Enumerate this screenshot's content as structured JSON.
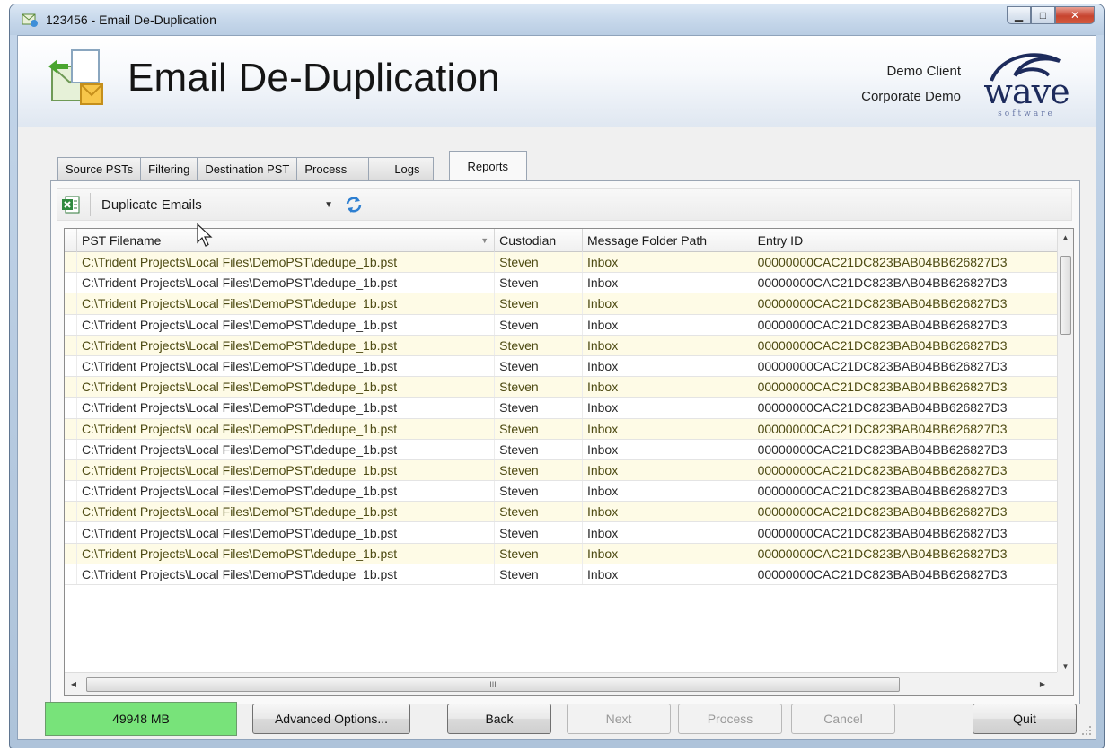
{
  "window": {
    "title": "123456 - Email De-Duplication",
    "controls": {
      "minimize": "▁",
      "maximize": "□",
      "close": "✕"
    }
  },
  "header": {
    "app_title": "Email De-Duplication",
    "client_name": "Demo Client",
    "client_project": "Corporate Demo",
    "logo_text": "wave",
    "logo_subtext": "software"
  },
  "tabs": [
    {
      "label": "Source PSTs",
      "active": false
    },
    {
      "label": "Filtering",
      "active": false
    },
    {
      "label": "Destination PST",
      "active": false
    },
    {
      "label": "Process",
      "active": false
    },
    {
      "label": "Logs",
      "active": false
    },
    {
      "label": "Reports",
      "active": true
    }
  ],
  "toolbar": {
    "report_type": "Duplicate Emails",
    "excel_icon": "excel-export-icon",
    "refresh_icon": "refresh-icon"
  },
  "grid": {
    "columns": [
      "PST Filename",
      "Custodian",
      "Message Folder Path",
      "Entry ID"
    ],
    "rows": [
      [
        "C:\\Trident Projects\\Local Files\\DemoPST\\dedupe_1b.pst",
        "Steven",
        "Inbox",
        "00000000CAC21DC823BAB04BB626827D3"
      ],
      [
        "C:\\Trident Projects\\Local Files\\DemoPST\\dedupe_1b.pst",
        "Steven",
        "Inbox",
        "00000000CAC21DC823BAB04BB626827D3"
      ],
      [
        "C:\\Trident Projects\\Local Files\\DemoPST\\dedupe_1b.pst",
        "Steven",
        "Inbox",
        "00000000CAC21DC823BAB04BB626827D3"
      ],
      [
        "C:\\Trident Projects\\Local Files\\DemoPST\\dedupe_1b.pst",
        "Steven",
        "Inbox",
        "00000000CAC21DC823BAB04BB626827D3"
      ],
      [
        "C:\\Trident Projects\\Local Files\\DemoPST\\dedupe_1b.pst",
        "Steven",
        "Inbox",
        "00000000CAC21DC823BAB04BB626827D3"
      ],
      [
        "C:\\Trident Projects\\Local Files\\DemoPST\\dedupe_1b.pst",
        "Steven",
        "Inbox",
        "00000000CAC21DC823BAB04BB626827D3"
      ],
      [
        "C:\\Trident Projects\\Local Files\\DemoPST\\dedupe_1b.pst",
        "Steven",
        "Inbox",
        "00000000CAC21DC823BAB04BB626827D3"
      ],
      [
        "C:\\Trident Projects\\Local Files\\DemoPST\\dedupe_1b.pst",
        "Steven",
        "Inbox",
        "00000000CAC21DC823BAB04BB626827D3"
      ],
      [
        "C:\\Trident Projects\\Local Files\\DemoPST\\dedupe_1b.pst",
        "Steven",
        "Inbox",
        "00000000CAC21DC823BAB04BB626827D3"
      ],
      [
        "C:\\Trident Projects\\Local Files\\DemoPST\\dedupe_1b.pst",
        "Steven",
        "Inbox",
        "00000000CAC21DC823BAB04BB626827D3"
      ],
      [
        "C:\\Trident Projects\\Local Files\\DemoPST\\dedupe_1b.pst",
        "Steven",
        "Inbox",
        "00000000CAC21DC823BAB04BB626827D3"
      ],
      [
        "C:\\Trident Projects\\Local Files\\DemoPST\\dedupe_1b.pst",
        "Steven",
        "Inbox",
        "00000000CAC21DC823BAB04BB626827D3"
      ],
      [
        "C:\\Trident Projects\\Local Files\\DemoPST\\dedupe_1b.pst",
        "Steven",
        "Inbox",
        "00000000CAC21DC823BAB04BB626827D3"
      ],
      [
        "C:\\Trident Projects\\Local Files\\DemoPST\\dedupe_1b.pst",
        "Steven",
        "Inbox",
        "00000000CAC21DC823BAB04BB626827D3"
      ],
      [
        "C:\\Trident Projects\\Local Files\\DemoPST\\dedupe_1b.pst",
        "Steven",
        "Inbox",
        "00000000CAC21DC823BAB04BB626827D3"
      ],
      [
        "C:\\Trident Projects\\Local Files\\DemoPST\\dedupe_1b.pst",
        "Steven",
        "Inbox",
        "00000000CAC21DC823BAB04BB626827D3"
      ]
    ],
    "hscroll_thumb_grip": "III"
  },
  "bottom": {
    "status_value": "49948 MB",
    "status_color": "#78e37a",
    "buttons": {
      "advanced": "Advanced Options...",
      "back": "Back",
      "next": "Next",
      "process": "Process",
      "cancel": "Cancel",
      "quit": "Quit"
    }
  },
  "colors": {
    "row_alt": "#fefbe6",
    "row_alt_text": "#4d4a12",
    "title_text": "#151515"
  }
}
